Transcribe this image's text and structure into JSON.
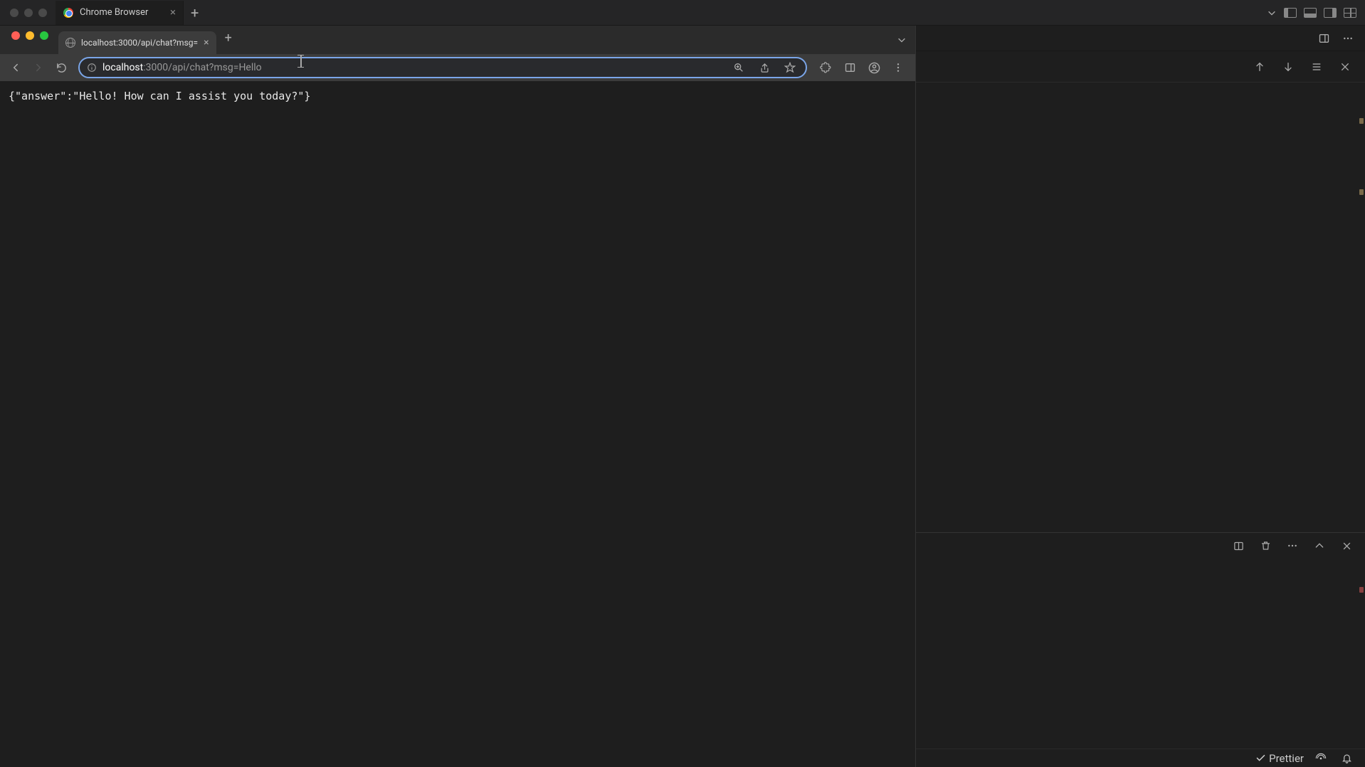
{
  "outer": {
    "tab_title": "Chrome Browser"
  },
  "chrome": {
    "tab_title": "localhost:3000/api/chat?msg=",
    "url_host": "localhost",
    "url_path": ":3000/api/chat?msg=Hello",
    "response": "{\"answer\":\"Hello! How can I assist you today?\"}"
  },
  "statusbar": {
    "prettier": "Prettier"
  }
}
